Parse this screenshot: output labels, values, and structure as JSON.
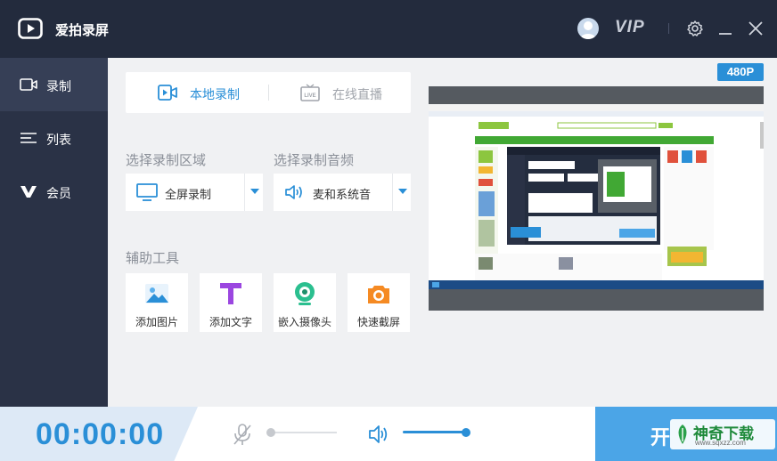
{
  "app": {
    "title": "爱拍录屏",
    "vip_label": "VIP"
  },
  "sidebar": {
    "items": [
      {
        "label": "录制",
        "icon": "record-icon",
        "active": true
      },
      {
        "label": "列表",
        "icon": "list-icon",
        "active": false
      },
      {
        "label": "会员",
        "icon": "vip-v-icon",
        "active": false
      }
    ]
  },
  "mode": {
    "local_label": "本地录制",
    "live_label": "在线直播",
    "selected": "local"
  },
  "area": {
    "section_label": "选择录制区域",
    "value": "全屏录制"
  },
  "audio": {
    "section_label": "选择录制音频",
    "value": "麦和系统音"
  },
  "tools": {
    "section_label": "辅助工具",
    "items": [
      {
        "label": "添加图片",
        "icon": "image-icon"
      },
      {
        "label": "添加文字",
        "icon": "text-t-icon"
      },
      {
        "label": "嵌入摄像头",
        "icon": "webcam-icon"
      },
      {
        "label": "快速截屏",
        "icon": "camera-icon"
      }
    ]
  },
  "preview": {
    "resolution": "480P"
  },
  "bottom": {
    "timer": "00:00:00",
    "mic_level": 0.0,
    "speaker_level": 1.0,
    "start_label": "开"
  },
  "watermark": {
    "text": "神奇下载",
    "sub": "www.sqxzz.com"
  },
  "colors": {
    "accent": "#2a8fd7",
    "titlebar": "#232b3d",
    "sidebar": "#2a3246",
    "bg": "#f0f1f3"
  }
}
